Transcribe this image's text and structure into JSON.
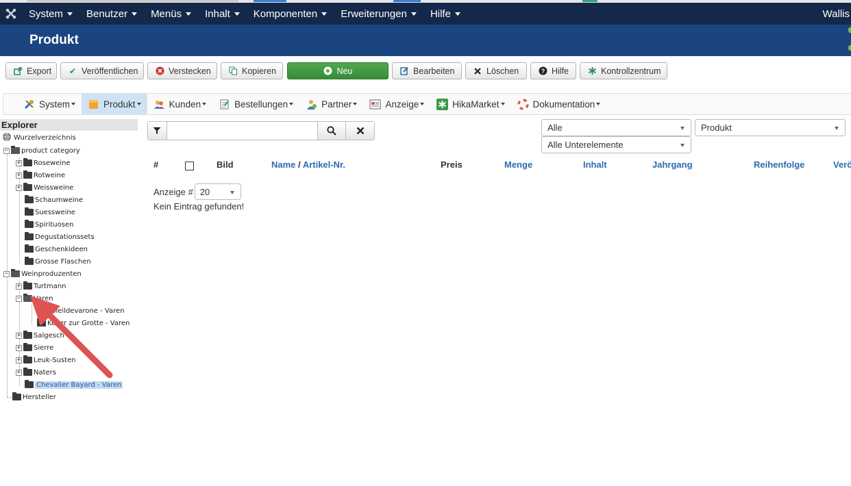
{
  "topnav": {
    "items": [
      "System",
      "Benutzer",
      "Menüs",
      "Inhalt",
      "Komponenten",
      "Erweiterungen",
      "Hilfe"
    ],
    "user": "Wallis"
  },
  "title": "Produkt",
  "toolbar": {
    "export": "Export",
    "publish": "Veröffentlichen",
    "hide": "Verstecken",
    "copy": "Kopieren",
    "new": "Neu",
    "edit": "Bearbeiten",
    "delete": "Löschen",
    "help": "Hilfe",
    "control": "Kontrollzentrum"
  },
  "hikamenu": [
    "System",
    "Produkt",
    "Kunden",
    "Bestellungen",
    "Partner",
    "Anzeige",
    "HikaMarket",
    "Dokumentation"
  ],
  "explorer": {
    "heading": "Explorer",
    "root": "Wurzelverzeichnis",
    "product_category": "product category",
    "cats": [
      "Roseweine",
      "Rotweine",
      "Weissweine",
      "Schaumweine",
      "Suessweine",
      "Spirituosen",
      "Degustationssets",
      "Geschenkideen",
      "Grosse Flaschen"
    ],
    "weinproduzenten": "Weinproduzenten",
    "producers": [
      "Turtmann",
      "Varen",
      "Soleildevarone - Varen",
      "Keller zur Grotte - Varen",
      "Salgesch",
      "Sierre",
      "Leuk-Susten",
      "Naters",
      "Chevalier Bayard - Varen"
    ],
    "hersteller": "Hersteller"
  },
  "filters": {
    "search_value": "",
    "status": "Alle",
    "type": "Produkt",
    "sub": "Alle Unterelemente"
  },
  "table": {
    "hash": "#",
    "bild": "Bild",
    "name": "Name",
    "slash": "/",
    "artikel": "Artikel-Nr.",
    "preis": "Preis",
    "menge": "Menge",
    "inhalt": "Inhalt",
    "jahrgang": "Jahrgang",
    "reihenfolge": "Reihenfolge",
    "veroeff": "Veröffentlicht"
  },
  "pager": {
    "label": "Anzeige #",
    "value": "20"
  },
  "empty_message": "Kein Eintrag gefunden!",
  "colors": {
    "topnav": "#14284a",
    "titlebar": "#1b4580",
    "link": "#2a6cb0",
    "arrow": "#e05353",
    "green": "#4fa84f"
  }
}
